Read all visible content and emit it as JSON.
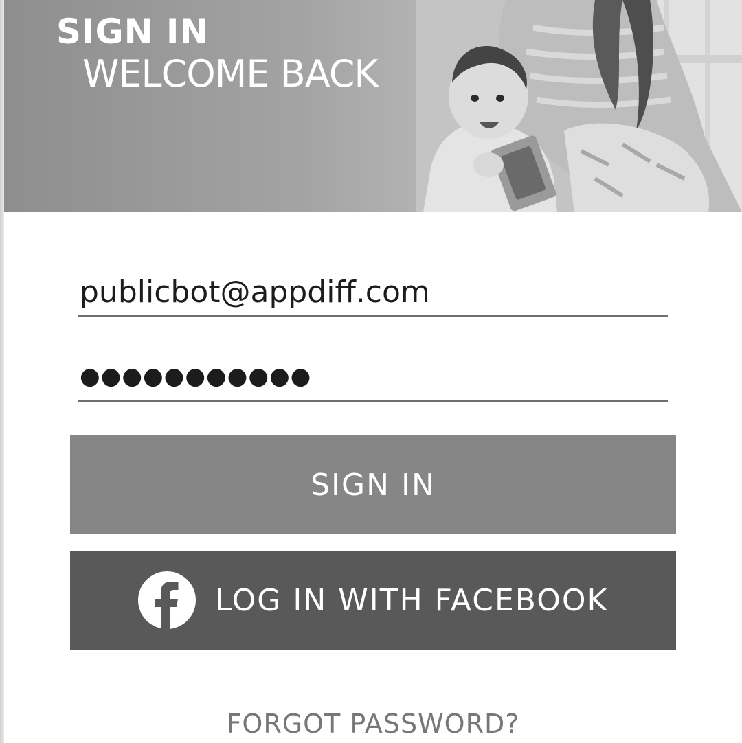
{
  "header": {
    "title": "SIGN IN",
    "subtitle": "WELCOME BACK"
  },
  "form": {
    "email_value": "publicbot@appdiff.com",
    "password_masked": "●●●●●●●●●●●"
  },
  "buttons": {
    "sign_in_label": "SIGN IN",
    "facebook_label": "LOG IN WITH FACEBOOK",
    "facebook_icon": "facebook-icon"
  },
  "links": {
    "forgot_password": "FORGOT PASSWORD?"
  },
  "colors": {
    "sign_in_bg": "#868686",
    "facebook_bg": "#595959",
    "field_underline": "#6e6e6e",
    "link_text": "#777777"
  }
}
